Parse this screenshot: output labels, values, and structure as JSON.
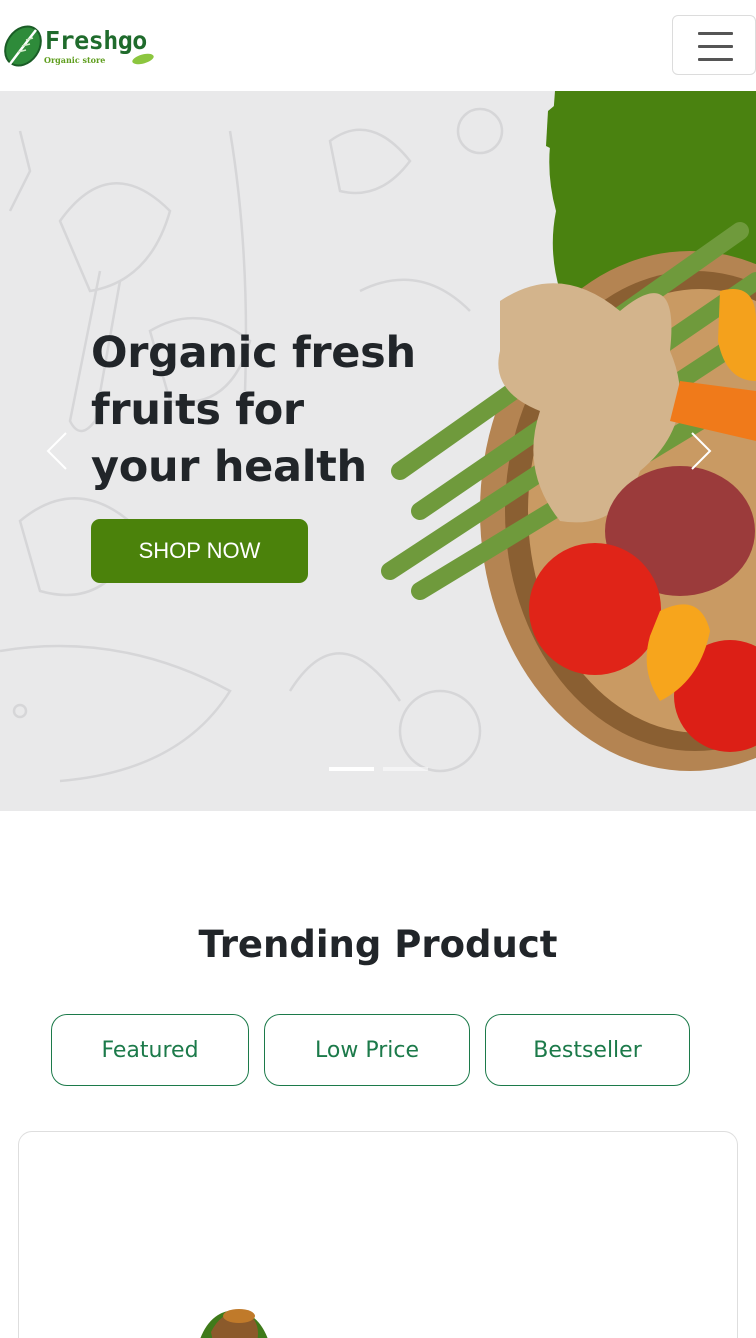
{
  "header": {
    "brand_name": "Freshgo",
    "brand_tagline": "Organic store",
    "menu_icon": "hamburger-menu-icon"
  },
  "hero": {
    "title_line1": "Organic fresh",
    "title_line2": "fruits for",
    "title_line3": "your health",
    "cta_label": "SHOP NOW",
    "prev_icon": "chevron-left-icon",
    "next_icon": "chevron-right-icon",
    "slides_total": 2,
    "active_slide": 1
  },
  "trending": {
    "title": "Trending Product",
    "filters": [
      "Featured",
      "Low Price",
      "Bestseller"
    ]
  },
  "colors": {
    "accent_green": "#4b820b",
    "filter_green": "#1c7a4a",
    "brand_green": "#1f6b2c"
  }
}
